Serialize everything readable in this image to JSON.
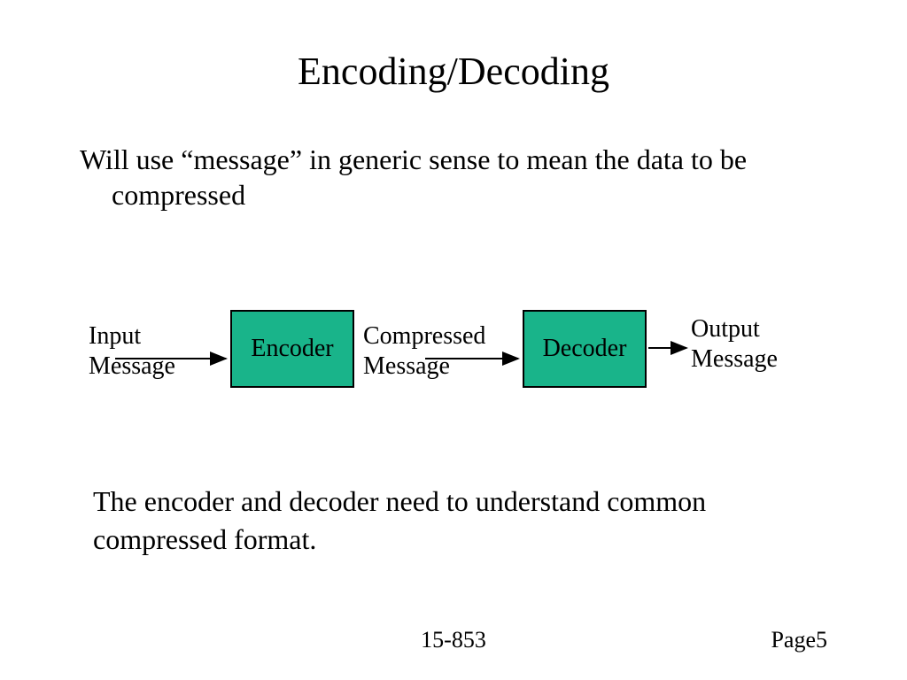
{
  "title": "Encoding/Decoding",
  "intro": "Will use “message” in generic sense to mean the data to be compressed",
  "diagram": {
    "input_label": "Input\nMessage",
    "encoder_label": "Encoder",
    "compressed_label": "Compressed\nMessage",
    "decoder_label": "Decoder",
    "output_label": "Output\nMessage",
    "box_fill": "#19b48a"
  },
  "conclusion": "The encoder and decoder need to understand common compressed format.",
  "footer": {
    "course": "15-853",
    "page": "Page5"
  }
}
